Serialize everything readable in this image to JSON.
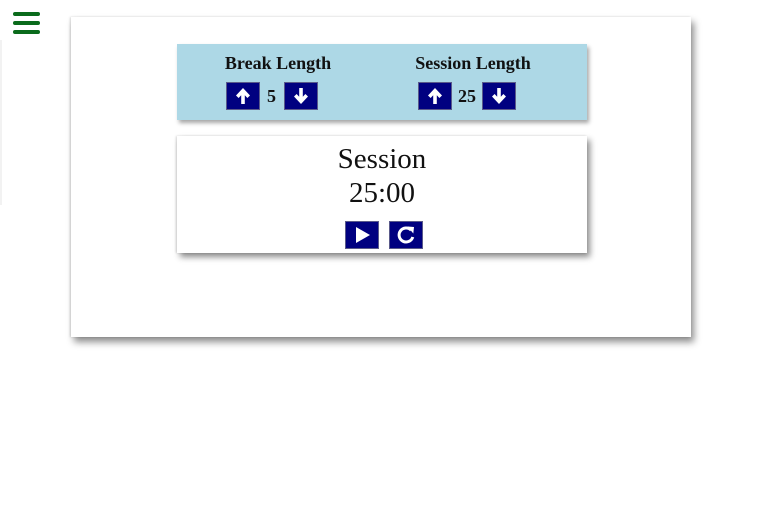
{
  "menu": {
    "icon": "hamburger-menu-icon",
    "color": "#0a6b1c"
  },
  "settings": {
    "break": {
      "label": "Break Length",
      "value": "5",
      "increment_icon": "arrow-up-icon",
      "decrement_icon": "arrow-down-icon"
    },
    "session": {
      "label": "Session Length",
      "value": "25",
      "increment_icon": "arrow-up-icon",
      "decrement_icon": "arrow-down-icon"
    },
    "panel_color": "#add8e6"
  },
  "timer": {
    "label": "Session",
    "display": "25:00",
    "start_icon": "play-icon",
    "reset_icon": "refresh-icon"
  },
  "colors": {
    "button_bg": "#000080",
    "icon": "#ffffff"
  }
}
